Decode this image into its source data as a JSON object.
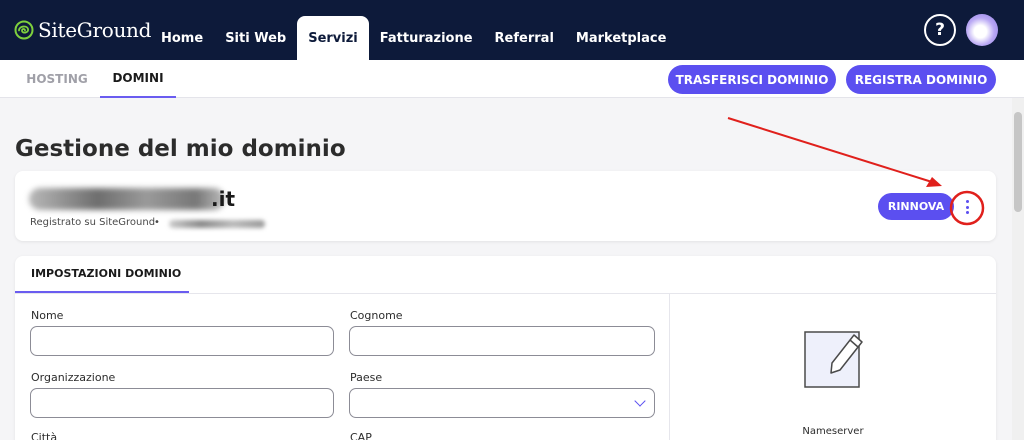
{
  "brand": {
    "name": "SiteGround",
    "accent": "#5b4ff0",
    "navbar_bg": "#0d1a3a",
    "logo_green": "#7ed03d"
  },
  "nav": {
    "items": [
      {
        "label": "Home",
        "active": false
      },
      {
        "label": "Siti Web",
        "active": false
      },
      {
        "label": "Servizi",
        "active": true
      },
      {
        "label": "Fatturazione",
        "active": false
      },
      {
        "label": "Referral",
        "active": false
      },
      {
        "label": "Marketplace",
        "active": false
      }
    ],
    "help_label": "?"
  },
  "subnav": {
    "tabs": [
      {
        "label": "HOSTING",
        "active": false
      },
      {
        "label": "DOMINI",
        "active": true
      }
    ],
    "transfer_button": "TRASFERISCI DOMINIO",
    "register_button": "REGISTRA DOMINIO"
  },
  "page": {
    "title": "Gestione del mio dominio"
  },
  "domain": {
    "tld": ".it",
    "registered_label": "Registrato su SiteGround",
    "separator": "•",
    "renew_button": "RINNOVA",
    "name_redacted": true
  },
  "settings": {
    "tab_label": "IMPOSTAZIONI DOMINIO",
    "fields": {
      "nome": {
        "label": "Nome",
        "value": ""
      },
      "cognome": {
        "label": "Cognome",
        "value": ""
      },
      "organizzazione": {
        "label": "Organizzazione",
        "value": ""
      },
      "paese": {
        "label": "Paese",
        "value": ""
      },
      "citta": {
        "label": "Città"
      },
      "cap": {
        "label": "CAP"
      }
    },
    "nameserver_label": "Nameserver"
  },
  "annotation": {
    "color": "#e0201c",
    "target": "more-options"
  }
}
